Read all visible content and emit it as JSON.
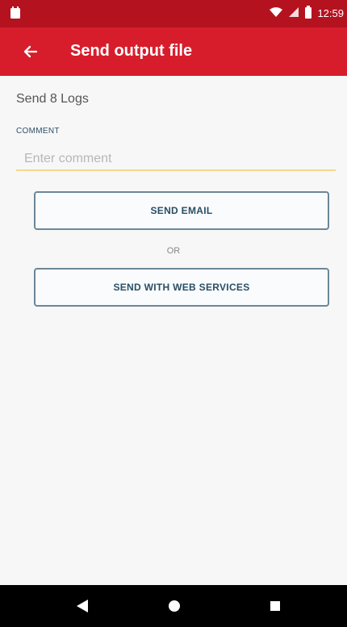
{
  "status_bar": {
    "time": "12:59",
    "icons": [
      "notification-icon",
      "wifi-icon",
      "signal-icon",
      "battery-icon"
    ]
  },
  "app_bar": {
    "back_icon": "arrow-back-icon",
    "title": "Send output file",
    "color": "#d71d2c"
  },
  "main": {
    "section_title": "Send 8 Logs",
    "comment_label": "COMMENT",
    "comment_placeholder": "Enter comment",
    "comment_value": "",
    "send_email_label": "SEND EMAIL",
    "or_label": "OR",
    "send_web_label": "SEND WITH WEB SERVICES"
  },
  "nav_bar": {
    "back_icon": "back-triangle-icon",
    "home_icon": "home-circle-icon",
    "recents_icon": "recents-square-icon"
  }
}
